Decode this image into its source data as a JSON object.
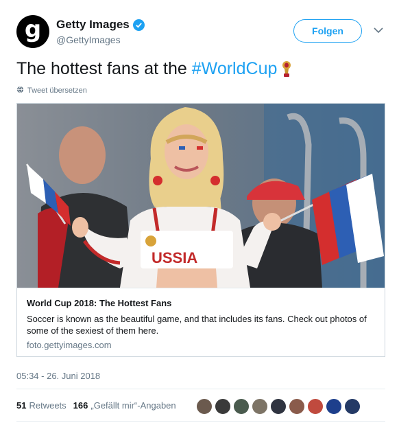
{
  "account": {
    "display_name": "Getty Images",
    "handle": "@GettyImages",
    "avatar_letter": "g",
    "verified": true
  },
  "follow_button": {
    "label": "Folgen"
  },
  "tweet": {
    "text": "The hottest fans at the",
    "hashtag": "#WorldCup",
    "emoji_icon": "world-cup-trophy-icon",
    "translate_label": "Tweet übersetzen"
  },
  "card": {
    "title": "World Cup 2018: The Hottest Fans",
    "description": "Soccer is known as the beautiful game, and that includes its fans. Check out photos of some of the sexiest of them here.",
    "domain": "foto.gettyimages.com",
    "shirt_text": "USSIA"
  },
  "meta": {
    "timestamp": "05:34 - 26. Juni 2018"
  },
  "stats": {
    "retweets_count": "51",
    "retweets_label": "Retweets",
    "likes_count": "166",
    "likes_label": "„Gefällt mir“-Angaben"
  },
  "likers": [
    {
      "color": "#6b5a4e"
    },
    {
      "color": "#3a3a3a"
    },
    {
      "color": "#4a5b4e"
    },
    {
      "color": "#7d7466"
    },
    {
      "color": "#2f3440"
    },
    {
      "color": "#8a5b4b"
    },
    {
      "color": "#c04a3e"
    },
    {
      "color": "#1d3f8c"
    },
    {
      "color": "#243a66"
    }
  ],
  "colors": {
    "accent": "#1da1f2",
    "text": "#14171a",
    "muted": "#657786",
    "border": "#ccd6dd"
  }
}
